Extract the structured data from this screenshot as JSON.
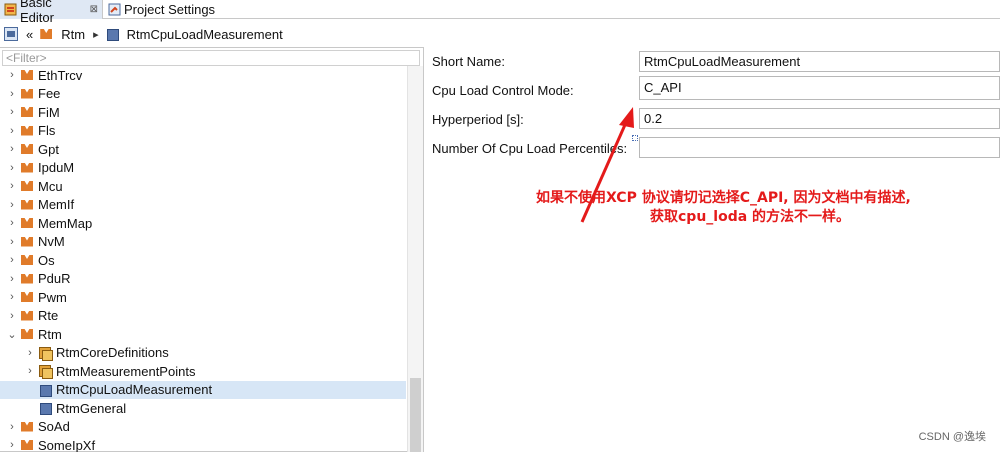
{
  "tabs": [
    {
      "label": "Basic Editor",
      "close": "⊠",
      "active": true
    },
    {
      "label": "Project Settings",
      "active": false
    }
  ],
  "breadcrumb": {
    "back_glyph": "«",
    "items": [
      "Rtm",
      "RtmCpuLoadMeasurement"
    ]
  },
  "tree": {
    "filter_placeholder": "<Filter>",
    "items": [
      {
        "label": "EthTrcv",
        "icon": "module-icon",
        "expand": "›"
      },
      {
        "label": "Fee",
        "icon": "module-icon",
        "expand": "›"
      },
      {
        "label": "FiM",
        "icon": "module-icon",
        "expand": "›"
      },
      {
        "label": "Fls",
        "icon": "module-icon",
        "expand": "›"
      },
      {
        "label": "Gpt",
        "icon": "module-icon",
        "expand": "›"
      },
      {
        "label": "IpduM",
        "icon": "module-icon",
        "expand": "›"
      },
      {
        "label": "Mcu",
        "icon": "module-icon",
        "expand": "›"
      },
      {
        "label": "MemIf",
        "icon": "module-icon",
        "expand": "›"
      },
      {
        "label": "MemMap",
        "icon": "module-icon",
        "expand": "›"
      },
      {
        "label": "NvM",
        "icon": "module-icon",
        "expand": "›"
      },
      {
        "label": "Os",
        "icon": "module-icon",
        "expand": "›"
      },
      {
        "label": "PduR",
        "icon": "module-icon",
        "expand": "›"
      },
      {
        "label": "Pwm",
        "icon": "module-icon",
        "expand": "›"
      },
      {
        "label": "Rte",
        "icon": "module-icon",
        "expand": "›"
      },
      {
        "label": "Rtm",
        "icon": "module-icon",
        "expand": "⌄"
      },
      {
        "label": "RtmCoreDefinitions",
        "icon": "container-icon",
        "expand": "›",
        "child": true
      },
      {
        "label": "RtmMeasurementPoints",
        "icon": "container-icon",
        "expand": "›",
        "child": true
      },
      {
        "label": "RtmCpuLoadMeasurement",
        "icon": "param-icon",
        "expand": "",
        "child": true,
        "selected": true
      },
      {
        "label": "RtmGeneral",
        "icon": "param-icon",
        "expand": "",
        "child": true
      },
      {
        "label": "SoAd",
        "icon": "module-icon",
        "expand": "›"
      },
      {
        "label": "SomeIpXf",
        "icon": "module-icon",
        "expand": "›"
      }
    ]
  },
  "form": {
    "short_name_label": "Short Name:",
    "short_name_value": "RtmCpuLoadMeasurement",
    "cpu_mode_label": "Cpu Load Control Mode:",
    "cpu_mode_value": "C_API",
    "hyperperiod_label": "Hyperperiod [s]:",
    "hyperperiod_value": "0.2",
    "percentiles_label": "Number Of Cpu Load Percentiles:",
    "percentiles_value": ""
  },
  "annotation": {
    "line1": "如果不使用XCP 协议请切记选择C_API, 因为文档中有描述,",
    "line2": "获取cpu_loda 的方法不一样。",
    "color": "#e41a1a"
  },
  "watermark": "CSDN @逸埃",
  "colors": {
    "selection": "#d7e6f6",
    "module_icon": "#e07b2a",
    "active_tab": "#dfe8f4"
  }
}
